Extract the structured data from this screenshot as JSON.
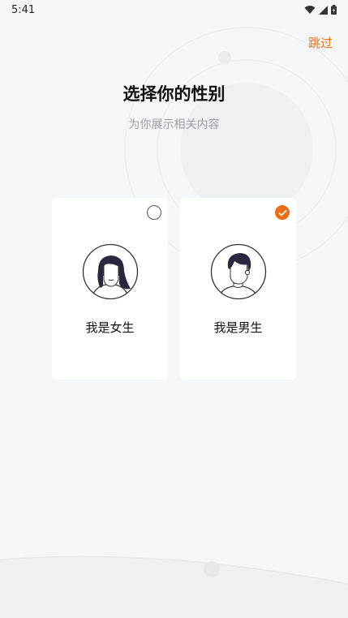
{
  "status": {
    "time": "5:41"
  },
  "header": {
    "skip_label": "跳过"
  },
  "page": {
    "title": "选择你的性别",
    "subtitle": "为你展示相关内容"
  },
  "options": [
    {
      "label": "我是女生",
      "selected": false,
      "avatar_icon": "female-avatar-icon"
    },
    {
      "label": "我是男生",
      "selected": true,
      "avatar_icon": "male-avatar-icon"
    }
  ],
  "colors": {
    "accent": "#ec6e14",
    "skip": "#e8731c",
    "background": "#f5f6f8",
    "card": "#ffffff",
    "subtitle": "#9a9ea6"
  }
}
